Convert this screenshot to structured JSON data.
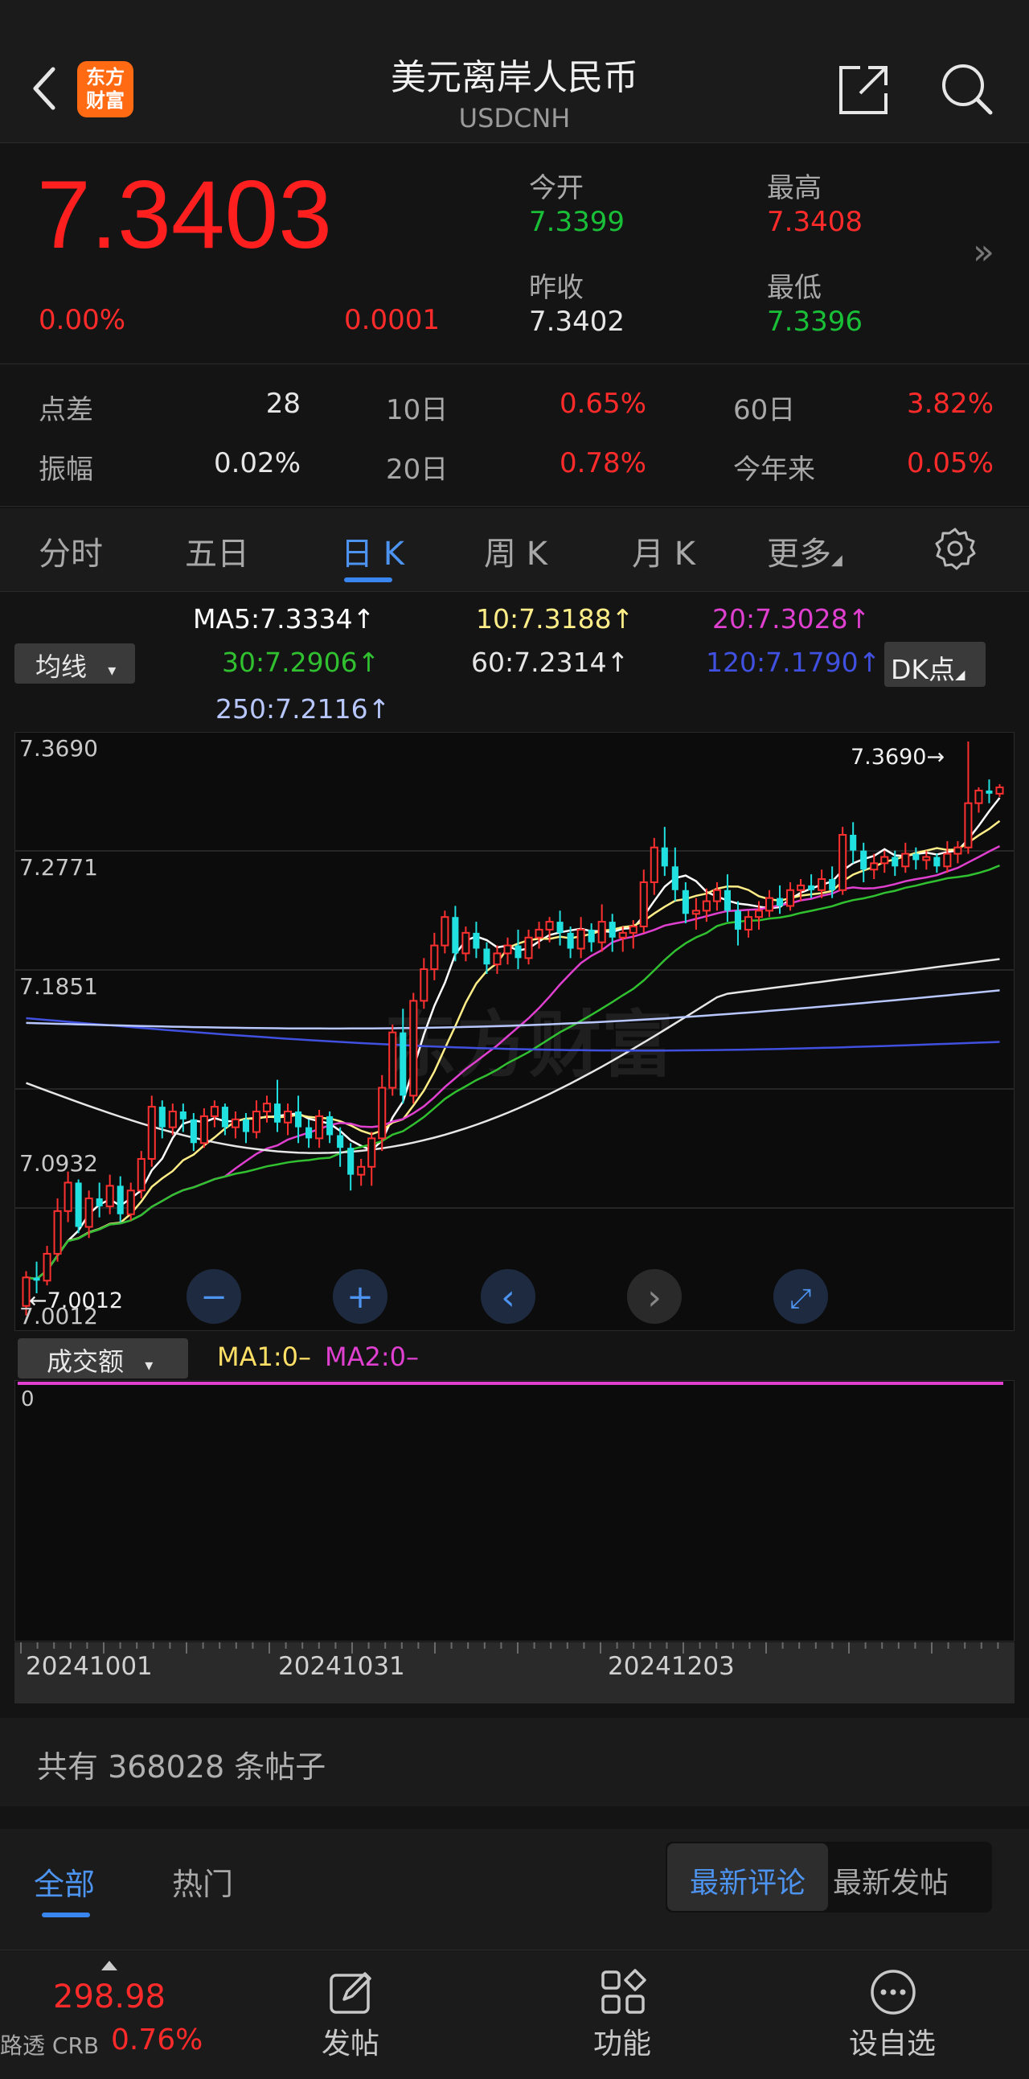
{
  "header": {
    "title": "美元离岸人民币",
    "subtitle": "USDCNH",
    "logo_text_line1": "东方",
    "logo_text_line2": "财富"
  },
  "quote": {
    "price": "7.3403",
    "change_pct": "0.00%",
    "change": "0.0001",
    "open_label": "今开",
    "open_value": "7.3399",
    "high_label": "最高",
    "high_value": "7.3408",
    "prev_close_label": "昨收",
    "prev_close_value": "7.3402",
    "low_label": "最低",
    "low_value": "7.3396",
    "more_glyph": "»"
  },
  "stats": {
    "spread_label": "点差",
    "spread_value": "28",
    "d10_label": "10日",
    "d10_value": "0.65%",
    "d60_label": "60日",
    "d60_value": "3.82%",
    "amplitude_label": "振幅",
    "amplitude_value": "0.02%",
    "d20_label": "20日",
    "d20_value": "0.78%",
    "ytd_label": "今年来",
    "ytd_value": "0.05%"
  },
  "tabs": {
    "intraday": "分时",
    "five_day": "五日",
    "daily": "日 K",
    "weekly": "周 K",
    "monthly": "月 K",
    "more": "更多",
    "more_caret": "◢"
  },
  "ma_legend": {
    "selector": "均线",
    "selector_caret": "▾",
    "ma5": "MA5:7.3334↑",
    "ma10": "10:7.3188↑",
    "ma20": "20:7.3028↑",
    "ma30": "30:7.2906↑",
    "ma60": "60:7.2314↑",
    "ma120": "120:7.1790↑",
    "ma250": "250:7.2116↑",
    "dk_button": "DK点",
    "dk_caret": "◢"
  },
  "colors": {
    "ma5": "#ffffff",
    "ma10": "#ffee88",
    "ma20": "#e040d0",
    "ma30": "#30c030",
    "ma60": "#e6e6e6",
    "ma120": "#4050e0",
    "ma250": "#b8c8ff",
    "up": "#ff3030",
    "down": "#20e0e0",
    "accent": "#3a86f0"
  },
  "kchart": {
    "y_tick_top": "7.3690",
    "y_tick_2": "7.2771",
    "y_tick_3": "7.1851",
    "y_tick_4": "7.0932",
    "y_tick_bottom": "7.0012",
    "max_marker": "7.3690→",
    "min_marker": "←7.0012",
    "zoom_out_glyph": "−",
    "zoom_in_glyph": "+",
    "prev_glyph": "‹",
    "next_glyph": "›",
    "expand_glyph": "⤢",
    "watermark": "东方财富"
  },
  "chart_data": {
    "type": "candlestick",
    "symbol": "USDCNH",
    "ylim": [
      7.0012,
      7.369
    ],
    "y_ticks": [
      7.369,
      7.2771,
      7.1851,
      7.0932,
      7.0012
    ],
    "x_labels": [
      "20241001",
      "20241031",
      "20241203"
    ],
    "max_marker": 7.369,
    "min_marker": 7.0012,
    "candles": [
      [
        7.012,
        7.03,
        7.006,
        7.034
      ],
      [
        7.03,
        7.028,
        7.02,
        7.04
      ],
      [
        7.028,
        7.045,
        7.025,
        7.05
      ],
      [
        7.045,
        7.072,
        7.04,
        7.08
      ],
      [
        7.072,
        7.09,
        7.065,
        7.097
      ],
      [
        7.09,
        7.062,
        7.058,
        7.092
      ],
      [
        7.062,
        7.08,
        7.055,
        7.085
      ],
      [
        7.08,
        7.075,
        7.068,
        7.09
      ],
      [
        7.075,
        7.088,
        7.07,
        7.095
      ],
      [
        7.088,
        7.07,
        7.065,
        7.094
      ],
      [
        7.07,
        7.085,
        7.066,
        7.09
      ],
      [
        7.085,
        7.105,
        7.08,
        7.11
      ],
      [
        7.105,
        7.138,
        7.1,
        7.145
      ],
      [
        7.138,
        7.125,
        7.118,
        7.142
      ],
      [
        7.125,
        7.135,
        7.12,
        7.14
      ],
      [
        7.135,
        7.13,
        7.122,
        7.14
      ],
      [
        7.13,
        7.115,
        7.11,
        7.134
      ],
      [
        7.115,
        7.132,
        7.112,
        7.137
      ],
      [
        7.132,
        7.138,
        7.125,
        7.142
      ],
      [
        7.138,
        7.125,
        7.12,
        7.14
      ],
      [
        7.125,
        7.13,
        7.118,
        7.135
      ],
      [
        7.13,
        7.122,
        7.115,
        7.134
      ],
      [
        7.122,
        7.135,
        7.118,
        7.142
      ],
      [
        7.135,
        7.14,
        7.128,
        7.145
      ],
      [
        7.14,
        7.128,
        7.122,
        7.155
      ],
      [
        7.128,
        7.135,
        7.12,
        7.14
      ],
      [
        7.135,
        7.125,
        7.115,
        7.145
      ],
      [
        7.125,
        7.118,
        7.112,
        7.13
      ],
      [
        7.118,
        7.132,
        7.112,
        7.136
      ],
      [
        7.132,
        7.12,
        7.115,
        7.135
      ],
      [
        7.12,
        7.112,
        7.1,
        7.125
      ],
      [
        7.112,
        7.095,
        7.085,
        7.115
      ],
      [
        7.095,
        7.1,
        7.088,
        7.105
      ],
      [
        7.1,
        7.118,
        7.088,
        7.122
      ],
      [
        7.118,
        7.15,
        7.11,
        7.158
      ],
      [
        7.15,
        7.185,
        7.145,
        7.19
      ],
      [
        7.185,
        7.145,
        7.14,
        7.2
      ],
      [
        7.145,
        7.205,
        7.14,
        7.21
      ],
      [
        7.205,
        7.225,
        7.2,
        7.232
      ],
      [
        7.225,
        7.24,
        7.218,
        7.248
      ],
      [
        7.24,
        7.258,
        7.235,
        7.262
      ],
      [
        7.258,
        7.235,
        7.23,
        7.265
      ],
      [
        7.235,
        7.248,
        7.23,
        7.252
      ],
      [
        7.248,
        7.238,
        7.232,
        7.255
      ],
      [
        7.238,
        7.228,
        7.222,
        7.242
      ],
      [
        7.228,
        7.235,
        7.222,
        7.24
      ],
      [
        7.235,
        7.24,
        7.228,
        7.245
      ],
      [
        7.24,
        7.232,
        7.225,
        7.25
      ],
      [
        7.232,
        7.245,
        7.228,
        7.25
      ],
      [
        7.245,
        7.25,
        7.238,
        7.255
      ],
      [
        7.25,
        7.255,
        7.242,
        7.258
      ],
      [
        7.255,
        7.248,
        7.24,
        7.262
      ],
      [
        7.248,
        7.238,
        7.232,
        7.252
      ],
      [
        7.238,
        7.25,
        7.232,
        7.258
      ],
      [
        7.25,
        7.242,
        7.236,
        7.254
      ],
      [
        7.242,
        7.255,
        7.236,
        7.266
      ],
      [
        7.255,
        7.245,
        7.236,
        7.26
      ],
      [
        7.245,
        7.248,
        7.236,
        7.252
      ],
      [
        7.248,
        7.252,
        7.238,
        7.256
      ],
      [
        7.252,
        7.28,
        7.248,
        7.288
      ],
      [
        7.28,
        7.302,
        7.272,
        7.308
      ],
      [
        7.302,
        7.29,
        7.284,
        7.315
      ],
      [
        7.29,
        7.275,
        7.268,
        7.302
      ],
      [
        7.275,
        7.26,
        7.254,
        7.28
      ],
      [
        7.26,
        7.262,
        7.25,
        7.27
      ],
      [
        7.262,
        7.268,
        7.255,
        7.276
      ],
      [
        7.268,
        7.275,
        7.262,
        7.28
      ],
      [
        7.275,
        7.262,
        7.255,
        7.285
      ],
      [
        7.262,
        7.25,
        7.24,
        7.268
      ],
      [
        7.25,
        7.258,
        7.245,
        7.262
      ],
      [
        7.258,
        7.262,
        7.25,
        7.268
      ],
      [
        7.262,
        7.27,
        7.258,
        7.275
      ],
      [
        7.27,
        7.265,
        7.26,
        7.278
      ],
      [
        7.265,
        7.275,
        7.262,
        7.28
      ],
      [
        7.275,
        7.278,
        7.268,
        7.282
      ],
      [
        7.278,
        7.275,
        7.27,
        7.285
      ],
      [
        7.275,
        7.282,
        7.27,
        7.288
      ],
      [
        7.282,
        7.275,
        7.27,
        7.29
      ],
      [
        7.275,
        7.31,
        7.272,
        7.315
      ],
      [
        7.31,
        7.3,
        7.292,
        7.318
      ],
      [
        7.3,
        7.288,
        7.28,
        7.305
      ],
      [
        7.288,
        7.292,
        7.282,
        7.298
      ],
      [
        7.292,
        7.296,
        7.286,
        7.3
      ],
      [
        7.296,
        7.29,
        7.284,
        7.3
      ],
      [
        7.29,
        7.298,
        7.286,
        7.305
      ],
      [
        7.298,
        7.294,
        7.288,
        7.302
      ],
      [
        7.294,
        7.296,
        7.288,
        7.3
      ],
      [
        7.296,
        7.29,
        7.286,
        7.298
      ],
      [
        7.29,
        7.298,
        7.286,
        7.306
      ],
      [
        7.298,
        7.302,
        7.292,
        7.306
      ],
      [
        7.302,
        7.33,
        7.298,
        7.369
      ],
      [
        7.33,
        7.338,
        7.324,
        7.34
      ],
      [
        7.338,
        7.336,
        7.33,
        7.345
      ],
      [
        7.336,
        7.34,
        7.334,
        7.342
      ]
    ],
    "candle_format": [
      "open",
      "close",
      "low",
      "high"
    ],
    "ma_lines": [
      {
        "name": "MA5",
        "start": 7.005,
        "end": 7.3334,
        "shape": "follow"
      },
      {
        "name": "MA10",
        "start": 7.02,
        "end": 7.3188,
        "shape": "follow"
      },
      {
        "name": "MA20",
        "start": 7.06,
        "end": 7.3028,
        "shape": "follow"
      },
      {
        "name": "MA30",
        "start": 7.075,
        "end": 7.2906,
        "shape": "follow"
      },
      {
        "name": "MA60",
        "start": 7.153,
        "end": 7.2314,
        "shape": "dip"
      },
      {
        "name": "MA120",
        "start": 7.194,
        "end": 7.179,
        "shape": "flat"
      },
      {
        "name": "MA250",
        "start": 7.191,
        "end": 7.2116,
        "shape": "flat"
      }
    ]
  },
  "volume": {
    "selector": "成交额",
    "selector_caret": "▾",
    "ma1": "MA1:0–",
    "ma2": "MA2:0–",
    "zero_label": "0"
  },
  "posts": {
    "count_text": "共有 368028 条帖子",
    "tab_all": "全部",
    "tab_hot": "热门",
    "sort_latest_comment": "最新评论",
    "sort_latest_post": "最新发帖"
  },
  "bottom_bar": {
    "crb_value": "298.98",
    "crb_name": "路透 CRB",
    "crb_pct": "0.76%",
    "post_label": "发帖",
    "functions_label": "功能",
    "watchlist_label": "设自选"
  }
}
